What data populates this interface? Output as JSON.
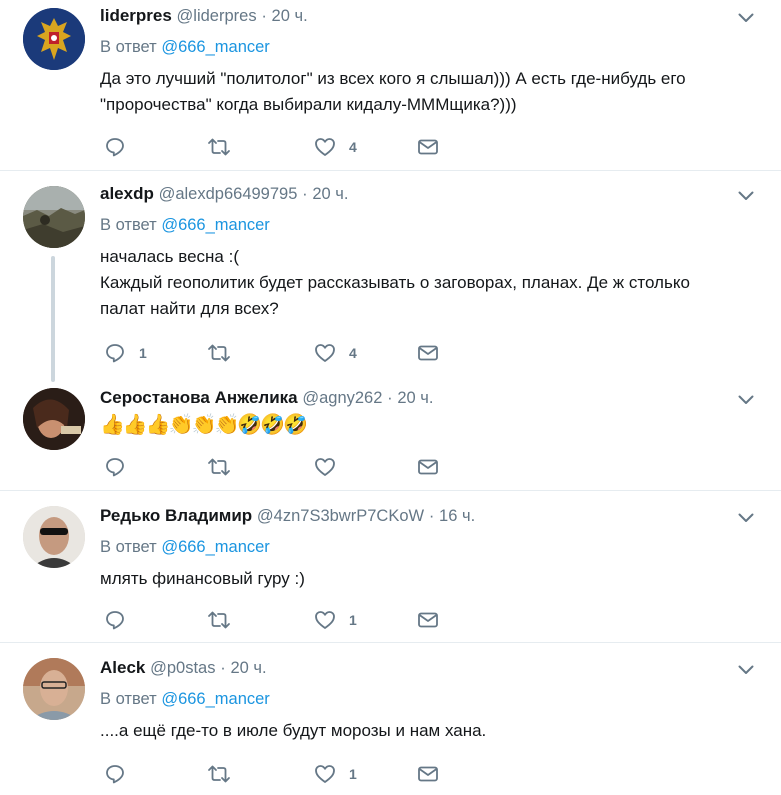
{
  "tweets": [
    {
      "name": "liderpres",
      "handle": "@liderpres",
      "sep": "·",
      "time": "20 ч.",
      "reply_prefix": "В ответ",
      "reply_to": "@666_mancer",
      "lines": [
        "Да это лучший \"политолог\" из всех кого я слышал))) А есть где-нибудь его",
        "\"пророчества\" когда выбирали кидалу-МММщика?)))"
      ],
      "replies": "",
      "retweets": "",
      "likes": "4"
    },
    {
      "name": "alexdp",
      "handle": "@alexdp66499795",
      "sep": "·",
      "time": "20 ч.",
      "reply_prefix": "В ответ",
      "reply_to": "@666_mancer",
      "lines": [
        "началась весна :(",
        "Каждый геополитик будет рассказывать о заговорах, планах. Де ж столько",
        "палат найти для всех?"
      ],
      "replies": "1",
      "retweets": "",
      "likes": "4"
    },
    {
      "name": "Серостанова Анжелика",
      "handle": "@agny262",
      "sep": "·",
      "time": "20 ч.",
      "emojis": "👍👍👍👏👏👏🤣🤣🤣",
      "replies": "",
      "retweets": "",
      "likes": ""
    },
    {
      "name": "Редько Владимир",
      "handle": "@4zn7S3bwrP7CKoW",
      "sep": "·",
      "time": "16 ч.",
      "reply_prefix": "В ответ",
      "reply_to": "@666_mancer",
      "lines": [
        "млять финансовый гуру :)"
      ],
      "replies": "",
      "retweets": "",
      "likes": "1"
    },
    {
      "name": "Aleck",
      "handle": "@p0stas",
      "sep": "·",
      "time": "20 ч.",
      "reply_prefix": "В ответ",
      "reply_to": "@666_mancer",
      "lines": [
        "....а ещё где-то в июле будут морозы и нам хана."
      ],
      "replies": "",
      "retweets": "",
      "likes": "1"
    }
  ],
  "icons": {
    "reply": "reply-icon",
    "retweet": "retweet-icon",
    "like": "heart-icon",
    "dm": "envelope-icon",
    "menu": "chevron-down-icon"
  },
  "colors": {
    "icon": "#657786",
    "mention": "#1b95e0",
    "divider": "#e6ecf0",
    "thread_line": "#ccd6dd"
  }
}
